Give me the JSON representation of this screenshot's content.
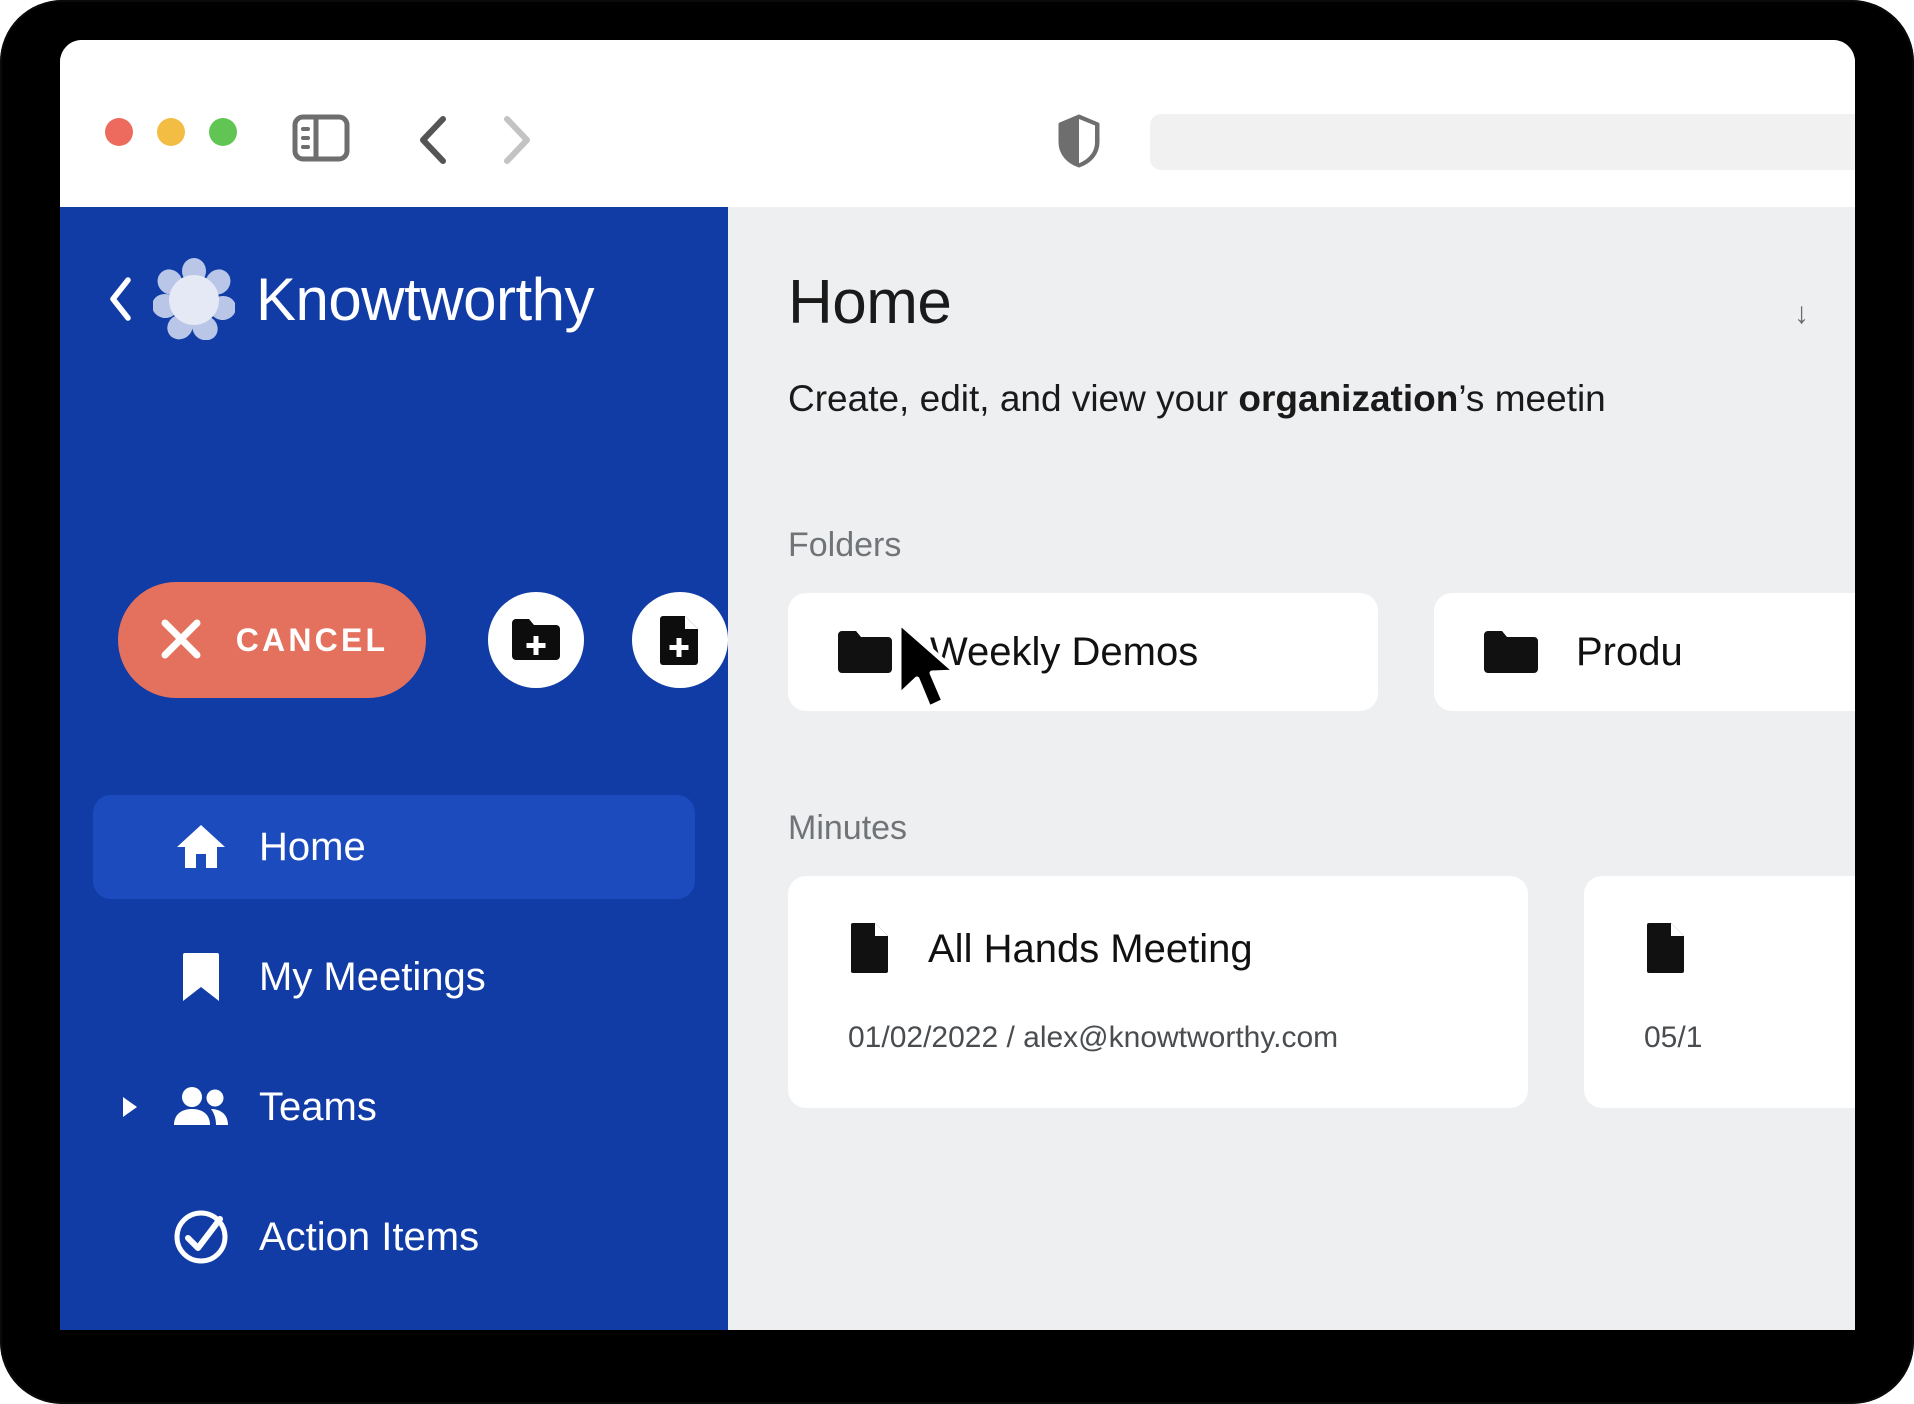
{
  "browser": {
    "traffic_lights": [
      "close",
      "minimize",
      "zoom"
    ],
    "sidebar_toggle_icon": "sidebar-toggle-icon",
    "back_icon": "chevron-left-icon",
    "forward_icon": "chevron-right-icon",
    "shield_icon": "shield-icon",
    "url_value": "",
    "url_placeholder": ""
  },
  "sidebar": {
    "back_icon": "chevron-left-icon",
    "logo_icon": "knowtworthy-logo-icon",
    "brand": "Knowtworthy",
    "cancel_label": "CANCEL",
    "cancel_icon": "close-x-icon",
    "cancel_color": "#E3715D",
    "new_folder_icon": "folder-plus-icon",
    "new_file_icon": "file-plus-icon",
    "background_color": "#113CA6",
    "active_color": "#1C4BBE",
    "items": [
      {
        "label": "Home",
        "icon": "home-icon",
        "active": true,
        "expandable": false
      },
      {
        "label": "My Meetings",
        "icon": "bookmark-icon",
        "active": false,
        "expandable": false
      },
      {
        "label": "Teams",
        "icon": "people-icon",
        "active": false,
        "expandable": true
      },
      {
        "label": "Action Items",
        "icon": "check-circle-icon",
        "active": false,
        "expandable": false
      }
    ]
  },
  "main": {
    "title": "Home",
    "subtitle_pre": "Create, edit, and view your ",
    "subtitle_bold": "organization",
    "subtitle_post": "’s meetin",
    "scroll_indicator": "↓",
    "folders_label": "Folders",
    "folders": [
      {
        "name": "Weekly Demos",
        "icon": "folder-icon"
      },
      {
        "name": "Produ",
        "icon": "folder-icon"
      }
    ],
    "minutes_label": "Minutes",
    "minutes": [
      {
        "title": "All Hands Meeting",
        "meta": "01/02/2022 / alex@knowtworthy.com",
        "icon": "file-icon"
      },
      {
        "title": "",
        "meta": "05/1",
        "icon": "file-icon"
      }
    ]
  }
}
